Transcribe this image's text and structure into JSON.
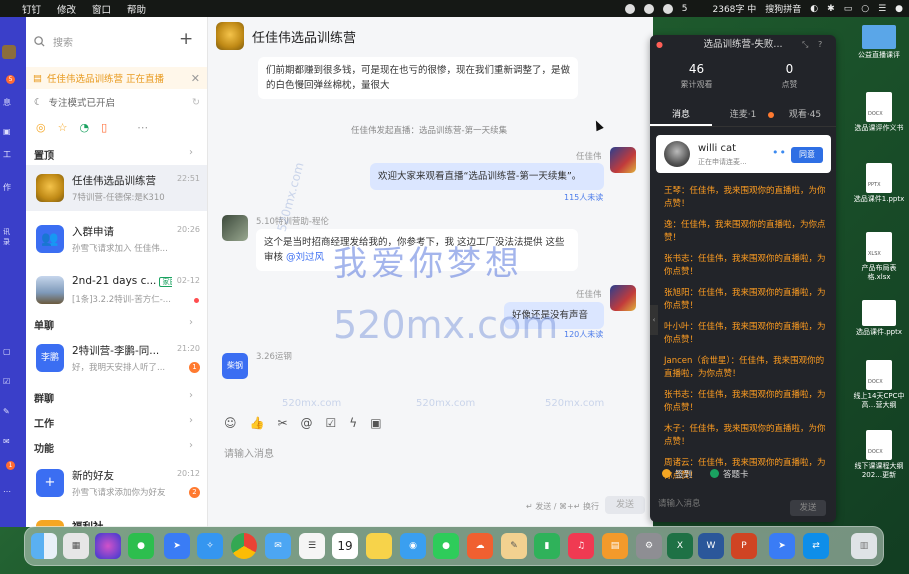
{
  "menubar": {
    "items": [
      "钉钉",
      "修改",
      "窗口",
      "帮助"
    ],
    "right_status": [
      "5",
      "2368字 中",
      "搜狗拼音"
    ]
  },
  "rail": {
    "badges": [
      "5",
      "1"
    ],
    "labels": [
      "息",
      "工",
      "作",
      "讯录"
    ]
  },
  "sidebar": {
    "search_placeholder": "搜索",
    "live_banner": "任佳伟选品训练营 正在直播",
    "focus_mode": "专注模式已开启",
    "sections": {
      "pinned": "置顶",
      "single": "单聊",
      "group": "群聊",
      "work": "工作",
      "func": "功能"
    },
    "conversations": [
      {
        "name": "任佳伟选品训练营",
        "sub": "7特训营-任德保:是K310",
        "time": "22:51",
        "avatar_color": "#d7a02a"
      },
      {
        "name": "入群申请",
        "sub": "孙雪飞请求加入 任佳伟...",
        "time": "20:26",
        "avatar_color": "#3b6ef2"
      },
      {
        "name": "2nd-21 days c...",
        "tag": "家族",
        "sub": "[1条]3.2.2特训-苦方仁-...",
        "time": "02-12",
        "avatar_color": "#8aa4c8"
      },
      {
        "name": "2特训营-李鹏-同...",
        "sub": "好，我明天安排人听了...",
        "time": "21:20",
        "badge": "1",
        "avatar_color": "#3b6ef2",
        "avatar_text": "李鹏"
      },
      {
        "name": "新的好友",
        "sub": "孙雪飞请求添加你为好友",
        "time": "20:12",
        "badge": "2",
        "avatar_color": "#3b6ef2"
      },
      {
        "name": "福利社",
        "sub": "",
        "time": "",
        "avatar_color": "#f5a623"
      }
    ]
  },
  "chat": {
    "title": "任佳伟选品训练营",
    "top_message": "们前期都赚到很多钱，可是现在也亏的很惨，现在我们重新调整了，是做的白色慢回弹丝棉枕，量很大",
    "system_line": "任佳伟发起直播：选品训练营-第一天续集",
    "msg1_sender": "任佳伟",
    "msg1_text": "欢迎大家来观看直播“选品训练营-第一天续集”。",
    "msg1_read": "115人未读",
    "msg2_sender": "5.10特训营助-程伦",
    "msg2_text": "这个是当时招商经理发给我的，你参考下，我 这边工厂没法法提供 这些审核",
    "msg2_mention": "@刘过风",
    "msg3_sender": "任佳伟",
    "msg3_text": "好像还是没有声音",
    "msg3_read": "120人未读",
    "msg4_sender": "3.26运钢",
    "msg4_avatar": "柴钢",
    "input_placeholder": "请输入消息",
    "send_hint": "↵ 发送 / ⌘+↵ 换行",
    "send_label": "发送"
  },
  "live_panel": {
    "title": "选品训练营-失败...",
    "stats": [
      {
        "num": "46",
        "label": "累计观看"
      },
      {
        "num": "0",
        "label": "点赞"
      }
    ],
    "tabs": [
      "消息",
      "连麦·1",
      "观看·45"
    ],
    "user_card": {
      "name": "willi cat",
      "status": "正在申请连麦...",
      "button": "同意"
    },
    "messages": [
      "王琴：任佳伟，我来围观你的直播啦，为你点赞！",
      "逸：任佳伟，我来围观你的直播啦，为你点赞！",
      "张书志：任佳伟，我来围观你的直播啦，为你点赞！",
      "张旭阳：任佳伟，我来围观你的直播啦，为你点赞！",
      "叶小叶：任佳伟，我来围观你的直播啦，为你点赞！",
      "Jancen（俞世星）：任佳伟，我来围观你的直播啦，为你点赞！",
      "张书志：任佳伟，我来围观你的直播啦，为你点赞！",
      "木子：任佳伟，我来围观你的直播啦，为你点赞！",
      "周诸云：任佳伟，我来围观你的直播啦，为你点赞！"
    ],
    "checkin": "签到",
    "answer": "答题卡",
    "input_placeholder": "请输入消息",
    "send_label": "发送"
  },
  "desktop_files": [
    "公益直播课评",
    "选品课评作义书",
    "选品课件1.pptx",
    "产品布局表格.xlsx",
    "选品课件.pptx",
    "线上14天CPC中高…营大纲",
    "线下课课程大纲202…更新"
  ],
  "watermark": {
    "cn": "我爱你梦想",
    "domain": "520mx.com"
  },
  "dock_apps": [
    "finder",
    "launchpad",
    "siri",
    "wechat",
    "dingtalk",
    "safari",
    "chrome",
    "mail",
    "reminders",
    "calendar",
    "notes",
    "qq-browser",
    "messages",
    "cloud",
    "script",
    "numbers",
    "music",
    "books",
    "settings",
    "excel",
    "word",
    "powerpoint",
    "feishu",
    "teamviewer",
    "trash"
  ],
  "dock_calendar_day": "19",
  "colors": {
    "rail": "#3a3fc9",
    "accent": "#2f6fe4",
    "live_bg": "#222429",
    "live_msg": "#ff9d21"
  }
}
